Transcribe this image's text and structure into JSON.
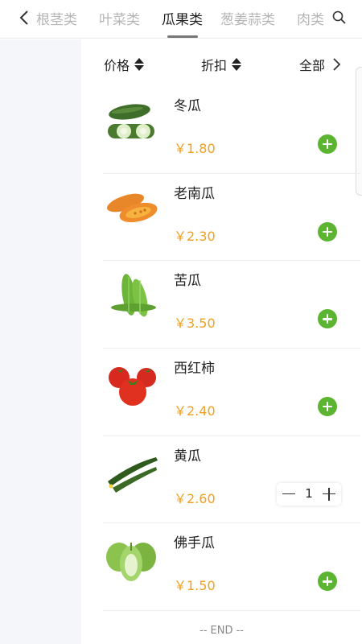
{
  "tabs": [
    {
      "label": "根茎类",
      "active": false
    },
    {
      "label": "叶菜类",
      "active": false
    },
    {
      "label": "瓜果类",
      "active": true
    },
    {
      "label": "葱姜蒜类",
      "active": false
    },
    {
      "label": "肉类",
      "active": false
    }
  ],
  "sort": {
    "price_label": "价格",
    "discount_label": "折扣",
    "all_label": "全部"
  },
  "products": [
    {
      "name": "冬瓜",
      "price": "￥1.80",
      "icon": "winter-melon-image",
      "in_cart": false
    },
    {
      "name": "老南瓜",
      "price": "￥2.30",
      "icon": "pumpkin-image",
      "in_cart": false
    },
    {
      "name": "苦瓜",
      "price": "￥3.50",
      "icon": "bitter-melon-image",
      "in_cart": false
    },
    {
      "name": "西红柿",
      "price": "￥2.40",
      "icon": "tomato-image",
      "in_cart": false
    },
    {
      "name": "黄瓜",
      "price": "￥2.60",
      "icon": "cucumber-image",
      "in_cart": true,
      "quantity": "1"
    },
    {
      "name": "佛手瓜",
      "price": "￥1.50",
      "icon": "chayote-image",
      "in_cart": false
    }
  ],
  "footer": {
    "end_text": "-- END --"
  },
  "colors": {
    "price": "#f0a020",
    "add_button": "#5cb531",
    "sidebar_bg": "#f4f6f9"
  }
}
